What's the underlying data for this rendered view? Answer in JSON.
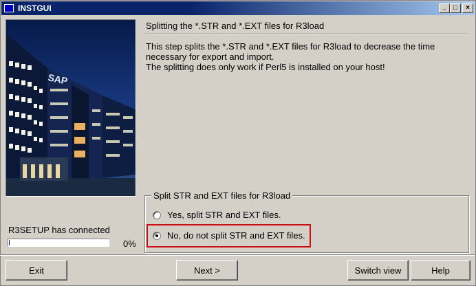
{
  "window": {
    "title": "INSTGUI"
  },
  "titlebar_buttons": {
    "minimize": "_",
    "maximize": "□",
    "close": "×"
  },
  "step": {
    "heading": "Splitting the *.STR and *.EXT files for R3load",
    "description": [
      "This step splits the *.STR and *.EXT files for R3load to decrease the time",
      "necessary for export and import.",
      "The splitting does only work if Perl5 is installed on your host!"
    ]
  },
  "group": {
    "label": "Split STR and EXT files for R3load",
    "options": [
      {
        "label": "Yes, split STR and EXT files.",
        "selected": false
      },
      {
        "label": "No, do not split STR and EXT files.",
        "selected": true
      }
    ]
  },
  "status": {
    "text": "R3SETUP has connected",
    "percent_text": "0%",
    "progress": 0.01
  },
  "buttons": {
    "exit": "Exit",
    "next": "Next >",
    "switch_view": "Switch view",
    "help": "Help"
  },
  "image": {
    "sign_text": "SAP"
  },
  "colors": {
    "titlebar": "#0a246a",
    "highlight": "#d01010",
    "face": "#d4d0c8"
  }
}
